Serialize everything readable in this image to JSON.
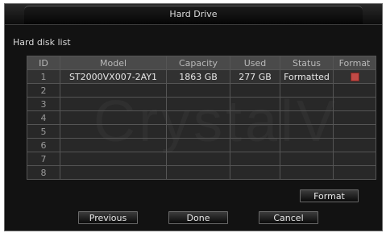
{
  "window": {
    "title": "Hard Drive"
  },
  "section": {
    "label": "Hard disk list"
  },
  "watermark": "CrystalV",
  "table": {
    "columns": [
      "ID",
      "Model",
      "Capacity",
      "Used",
      "Status",
      "Format"
    ],
    "rows": [
      {
        "id": "1",
        "model": "ST2000VX007-2AY1",
        "capacity": "1863 GB",
        "used": "277 GB",
        "status": "Formatted",
        "format_checked": true
      },
      {
        "id": "2",
        "model": "",
        "capacity": "",
        "used": "",
        "status": ""
      },
      {
        "id": "3",
        "model": "",
        "capacity": "",
        "used": "",
        "status": ""
      },
      {
        "id": "4",
        "model": "",
        "capacity": "",
        "used": "",
        "status": ""
      },
      {
        "id": "5",
        "model": "",
        "capacity": "",
        "used": "",
        "status": ""
      },
      {
        "id": "6",
        "model": "",
        "capacity": "",
        "used": "",
        "status": ""
      },
      {
        "id": "7",
        "model": "",
        "capacity": "",
        "used": "",
        "status": ""
      },
      {
        "id": "8",
        "model": "",
        "capacity": "",
        "used": "",
        "status": ""
      }
    ]
  },
  "buttons": {
    "format": "Format",
    "previous": "Previous",
    "done": "Done",
    "cancel": "Cancel"
  },
  "colors": {
    "background": "#121212",
    "header_cell": "#4a4a4a",
    "format_checkbox": "#c24a46"
  }
}
